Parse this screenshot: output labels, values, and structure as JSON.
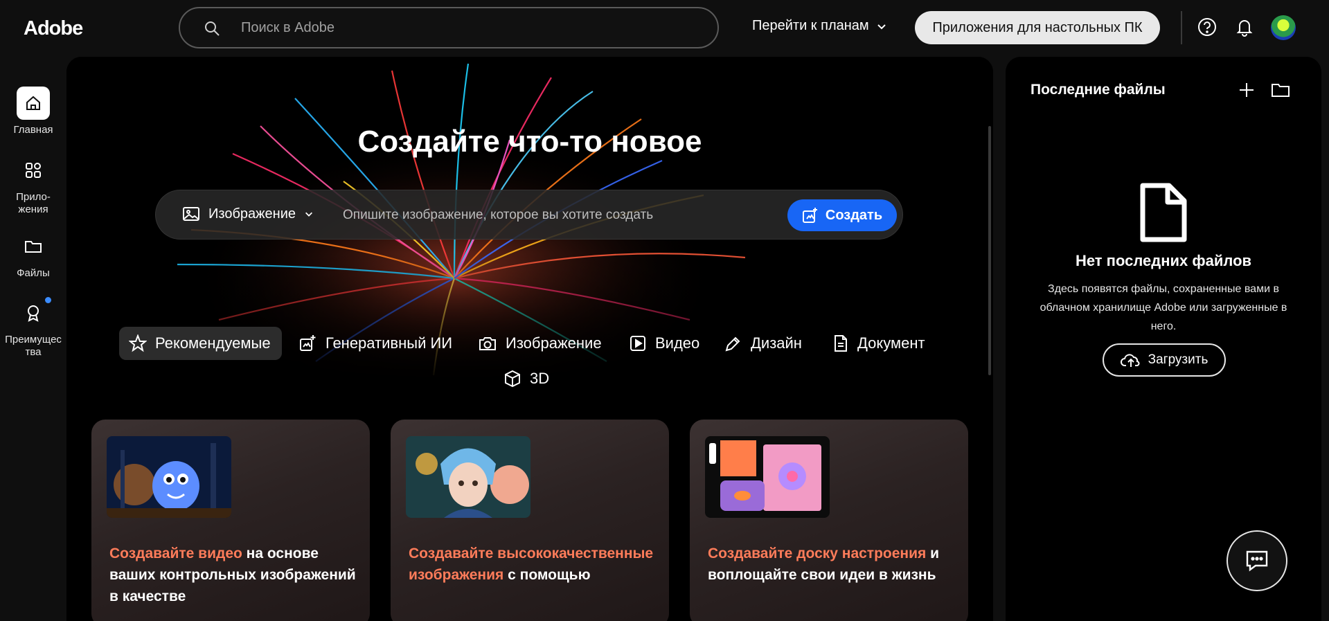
{
  "header": {
    "logo": "Adobe",
    "search_placeholder": "Поиск в Adobe",
    "plans_label": "Перейти к планам",
    "desktop_apps_label": "Приложения для настольных ПК"
  },
  "sidebar": {
    "items": [
      {
        "label": "Главная",
        "icon": "home-icon"
      },
      {
        "label": "Прило-\nжения",
        "icon": "apps-icon"
      },
      {
        "label": "Файлы",
        "icon": "folder-icon"
      },
      {
        "label": "Преимущес\nтва",
        "icon": "award-icon"
      }
    ]
  },
  "hero": {
    "title": "Создайте что-то новое",
    "type_label": "Изображение",
    "prompt_placeholder": "Опишите изображение, которое вы хотите создать",
    "create_label": "Создать"
  },
  "categories": [
    {
      "label": "Рекомендуемые",
      "icon": "star-icon",
      "active": true
    },
    {
      "label": "Генеративный ИИ",
      "icon": "sparkle-icon"
    },
    {
      "label": "Изображение",
      "icon": "camera-icon"
    },
    {
      "label": "Видео",
      "icon": "play-icon"
    },
    {
      "label": "Дизайн",
      "icon": "pen-icon"
    },
    {
      "label": "Документ",
      "icon": "document-icon"
    },
    {
      "label": "3D",
      "icon": "cube-icon"
    }
  ],
  "cards": [
    {
      "highlight": "Создавайте видео",
      "rest": " на основе ваших контрольных изображений в качестве"
    },
    {
      "highlight": "Создавайте высококачественные изображения",
      "rest": " с помощью"
    },
    {
      "highlight": "Создавайте доску настроения",
      "rest": " и воплощайте свои идеи в жизнь"
    }
  ],
  "recent": {
    "title": "Последние файлы",
    "empty_title": "Нет последних файлов",
    "empty_desc": "Здесь появятся файлы, сохраненные вами в облачном хранилище Adobe или загруженные в него.",
    "upload_label": "Загрузить"
  },
  "colors": {
    "accent_blue": "#1866f5",
    "highlight_coral": "#ff7c5a",
    "background": "#0f0f0f"
  }
}
